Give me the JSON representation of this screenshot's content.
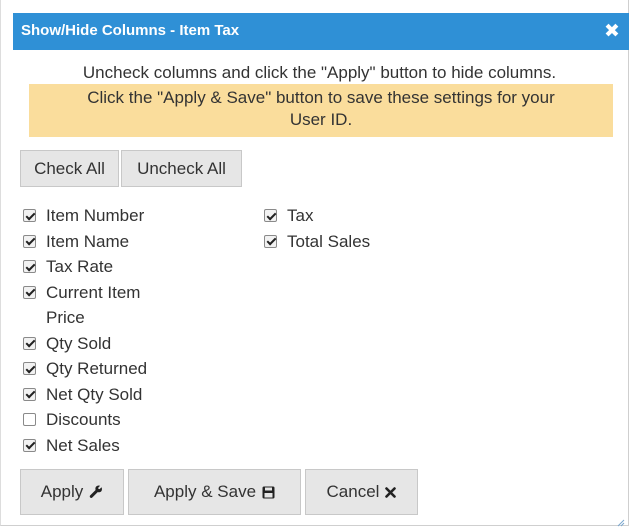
{
  "dialog": {
    "title": "Show/Hide Columns - Item Tax",
    "close_glyph": "✖",
    "close_icon": "close-icon"
  },
  "instructions": "Uncheck columns and click the \"Apply\" button to hide columns.",
  "notice": {
    "line1": "Click the \"Apply & Save\" button to save these settings for your",
    "line2": "User ID."
  },
  "buttons": {
    "check_all": "Check All",
    "uncheck_all": "Uncheck All",
    "apply": "Apply",
    "apply_icon": "wrench-icon",
    "apply_save": "Apply & Save",
    "apply_save_icon": "floppy-disk-icon",
    "cancel": "Cancel",
    "cancel_icon": "close-icon"
  },
  "columns": {
    "left": [
      {
        "label": "Item Number",
        "checked": true
      },
      {
        "label": "Item Name",
        "checked": true
      },
      {
        "label": "Tax Rate",
        "checked": true
      },
      {
        "label": "Current Item Price",
        "checked": true
      },
      {
        "label": "Qty Sold",
        "checked": true
      },
      {
        "label": "Qty Returned",
        "checked": true
      },
      {
        "label": "Net Qty Sold",
        "checked": true
      },
      {
        "label": "Discounts",
        "checked": false
      },
      {
        "label": "Net Sales",
        "checked": true
      }
    ],
    "right": [
      {
        "label": "Tax",
        "checked": true
      },
      {
        "label": "Total Sales",
        "checked": true
      }
    ]
  },
  "colors": {
    "titlebar": "#2f90d6",
    "notice_bg": "#fadd9c",
    "button_bg": "#e6e6e6"
  }
}
